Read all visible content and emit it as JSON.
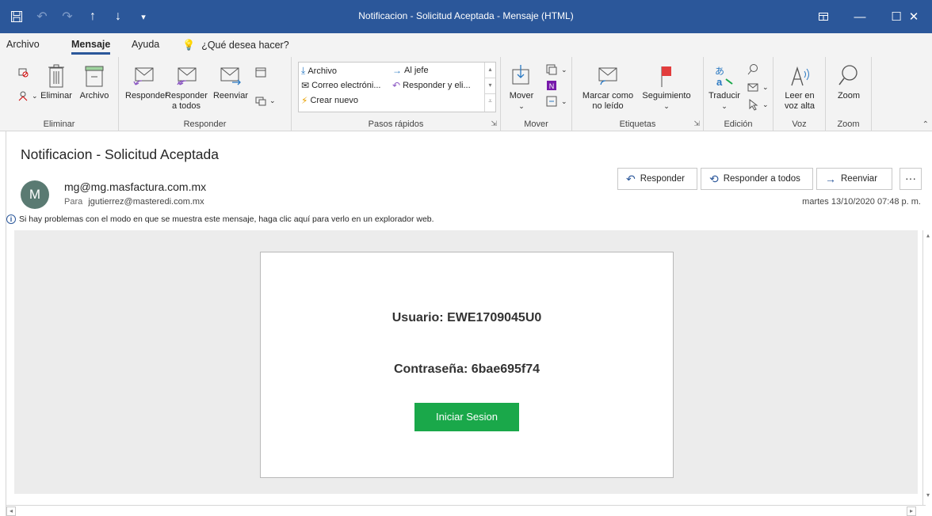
{
  "window": {
    "title": "Notificacion - Solicitud Aceptada  -  Mensaje (HTML)",
    "qat_icons": [
      "save-icon",
      "undo-icon",
      "redo-icon",
      "up-arrow-icon",
      "down-arrow-icon",
      "customize-icon"
    ],
    "controls": [
      "ribbon-display-icon",
      "minimize-icon",
      "maximize-icon",
      "close-icon"
    ],
    "accent_color": "#2b579a"
  },
  "tabs": {
    "archivo": "Archivo",
    "mensaje": "Mensaje",
    "ayuda": "Ayuda",
    "tell_me": "¿Qué desea hacer?"
  },
  "ribbon": {
    "eliminar": {
      "label": "Eliminar",
      "delete_btn": "Eliminar",
      "archive_btn": "Archivo"
    },
    "responder": {
      "label": "Responder",
      "reply": "Responder",
      "reply_all_1": "Responder",
      "reply_all_2": "a todos",
      "forward": "Reenviar"
    },
    "pasos_rapidos": {
      "label": "Pasos rápidos",
      "items": [
        "Archivo",
        "Al jefe",
        "Correo electróni...",
        "Responder y eli...",
        "Crear nuevo"
      ]
    },
    "mover": {
      "label": "Mover",
      "move": "Mover"
    },
    "etiquetas": {
      "label": "Etiquetas",
      "mark_unread_1": "Marcar como",
      "mark_unread_2": "no leído",
      "follow_up": "Seguimiento"
    },
    "edicion": {
      "label": "Edición",
      "translate": "Traducir"
    },
    "voz": {
      "label": "Voz",
      "read_aloud_1": "Leer en",
      "read_aloud_2": "voz alta"
    },
    "zoom": {
      "label": "Zoom",
      "zoom": "Zoom"
    }
  },
  "message": {
    "subject": "Notificacion - Solicitud Aceptada",
    "avatar_initial": "M",
    "sender": "mg@mg.masfactura.com.mx",
    "to_label": "Para",
    "to": "jgutierrez@masteredi.com.mx",
    "date": "martes 13/10/2020 07:48 p. m.",
    "info": "Si hay problemas con el modo en que se muestra este mensaje, haga clic aquí para verlo en un explorador web.",
    "actions": {
      "reply": "Responder",
      "reply_all": "Responder a todos",
      "forward": "Reenviar",
      "more": "···"
    }
  },
  "email_body": {
    "usuario": "Usuario: EWE1709045U0",
    "contrasena": "Contraseña: 6bae695f74",
    "login_button": "Iniciar Sesion",
    "button_color": "#1aa84a"
  }
}
